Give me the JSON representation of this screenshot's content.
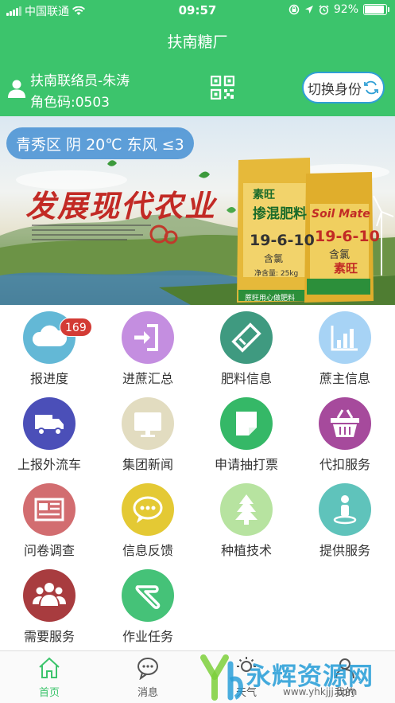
{
  "status_bar": {
    "carrier": "中国联通",
    "time": "09:57",
    "battery": "92%",
    "battery_level": 0.92
  },
  "header": {
    "title": "扶南糖厂",
    "user_name": "扶南联络员-朱涛",
    "role_code": "角色码:0503",
    "switch_label": "切换身份"
  },
  "banner": {
    "weather": "青秀区 阴 20℃ 东风 ≤3",
    "slogan": "发展现代农业",
    "product_brand": "素旺",
    "product_brand_en": "Soil Mate",
    "product_name": "掺混肥料",
    "product_formula": "19-6-10",
    "product_note": "含氯",
    "product_weight": "净含量: 25kg",
    "product_footer": "蔗旺用心做肥料"
  },
  "grid": [
    {
      "label": "报进度",
      "icon": "cloud-icon",
      "color": "#63b8d6",
      "badge": "169"
    },
    {
      "label": "进蔗汇总",
      "icon": "login-arrow-icon",
      "color": "#c48ee0"
    },
    {
      "label": "肥料信息",
      "icon": "ticket-icon",
      "color": "#3f9a80"
    },
    {
      "label": "蔗主信息",
      "icon": "bar-chart-icon",
      "color": "#a7d3f5"
    },
    {
      "label": "上报外流车",
      "icon": "truck-icon",
      "color": "#4b4fb8"
    },
    {
      "label": "集团新闻",
      "icon": "monitor-icon",
      "color": "#e2dcc0"
    },
    {
      "label": "申请抽打票",
      "icon": "note-icon",
      "color": "#35b867"
    },
    {
      "label": "代扣服务",
      "icon": "basket-icon",
      "color": "#a64a9c"
    },
    {
      "label": "问卷调查",
      "icon": "newspaper-icon",
      "color": "#d26d70"
    },
    {
      "label": "信息反馈",
      "icon": "chat-icon",
      "color": "#e4c934"
    },
    {
      "label": "种植技术",
      "icon": "tree-icon",
      "color": "#b7e3a0"
    },
    {
      "label": "提供服务",
      "icon": "person-pin-icon",
      "color": "#5fc3bb"
    },
    {
      "label": "需要服务",
      "icon": "group-icon",
      "color": "#a83c3f"
    },
    {
      "label": "作业任务",
      "icon": "hand-icon",
      "color": "#45c278"
    }
  ],
  "nav": [
    {
      "label": "首页",
      "icon": "home-icon",
      "active": true
    },
    {
      "label": "消息",
      "icon": "message-icon",
      "active": false
    },
    {
      "label": "天气",
      "icon": "weather-icon",
      "active": false
    },
    {
      "label": "我的",
      "icon": "profile-icon",
      "active": false
    }
  ],
  "watermark": {
    "brand": "永辉资源网",
    "url": "www.yhkjjj.com"
  },
  "colors": {
    "primary": "#3cc46c",
    "badge": "#d33b35",
    "switch_border": "#2f9fd5"
  }
}
